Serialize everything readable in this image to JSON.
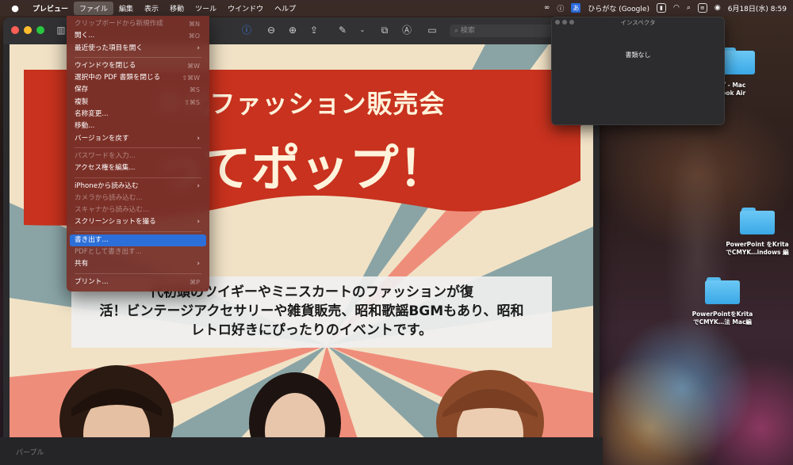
{
  "menubar": {
    "app_name": "プレビュー",
    "menus": [
      "ファイル",
      "編集",
      "表示",
      "移動",
      "ツール",
      "ウインドウ",
      "ヘルプ"
    ],
    "ime_label": "あ",
    "input_source": "ひらがな (Google)",
    "clock": "6月18日(水) 8:59"
  },
  "file_menu": {
    "items": [
      {
        "label": "クリップボードから新規作成",
        "shortcut": "⌘N",
        "disabled": true
      },
      {
        "label": "開く...",
        "shortcut": "⌘O"
      },
      {
        "label": "最近使った項目を開く",
        "submenu": true
      },
      {
        "separator": true
      },
      {
        "label": "ウインドウを閉じる",
        "shortcut": "⌘W"
      },
      {
        "label": "選択中の PDF 書類を閉じる",
        "shortcut": "⇧⌘W"
      },
      {
        "label": "保存",
        "shortcut": "⌘S"
      },
      {
        "label": "複製",
        "shortcut": "⇧⌘S"
      },
      {
        "label": "名称変更..."
      },
      {
        "label": "移動..."
      },
      {
        "label": "バージョンを戻す",
        "submenu": true
      },
      {
        "separator": true
      },
      {
        "label": "パスワードを入力...",
        "disabled": true
      },
      {
        "label": "アクセス権を編集..."
      },
      {
        "separator": true
      },
      {
        "label": "iPhoneから読み込む",
        "submenu": true
      },
      {
        "label": "カメラから読み込む...",
        "disabled": true
      },
      {
        "label": "スキャナから読み込む...",
        "disabled": true
      },
      {
        "label": "スクリーンショットを撮る",
        "submenu": true
      },
      {
        "separator": true
      },
      {
        "label": "書き出す...",
        "highlighted": true
      },
      {
        "label": "PDFとして書き出す...",
        "disabled": true
      },
      {
        "label": "共有",
        "submenu": true
      },
      {
        "separator": true
      },
      {
        "label": "プリント...",
        "shortcut": "⌘P"
      }
    ]
  },
  "preview": {
    "search_placeholder": "検索",
    "headline": "年代ファッション販売会",
    "big_title": "ってポップ！",
    "description_lines": [
      "代初頭のツイギーやミニスカートのファッションが復",
      "活！ビンテージアクセサリーや雑貨販売、昭和歌謡BGMもあり、昭和",
      "レトロ好きにぴったりのイベントです。"
    ],
    "status_text": "パープル"
  },
  "inspector": {
    "title": "インスペクタ",
    "empty_text": "書類なし"
  },
  "desktop_icons": [
    {
      "line1": "ップ - Mac",
      "line2": "cBook Air"
    },
    {
      "line1": "PowerPoint をKrita",
      "line2": "でCMYK…indows 編"
    },
    {
      "line1": "PowerPointをKrita",
      "line2": "でCMYK…法 Mac編"
    }
  ],
  "colors": {
    "menu_highlight": "#2d6fd8",
    "banner_red": "#c8321e",
    "folder_blue": "#4db6ee"
  }
}
